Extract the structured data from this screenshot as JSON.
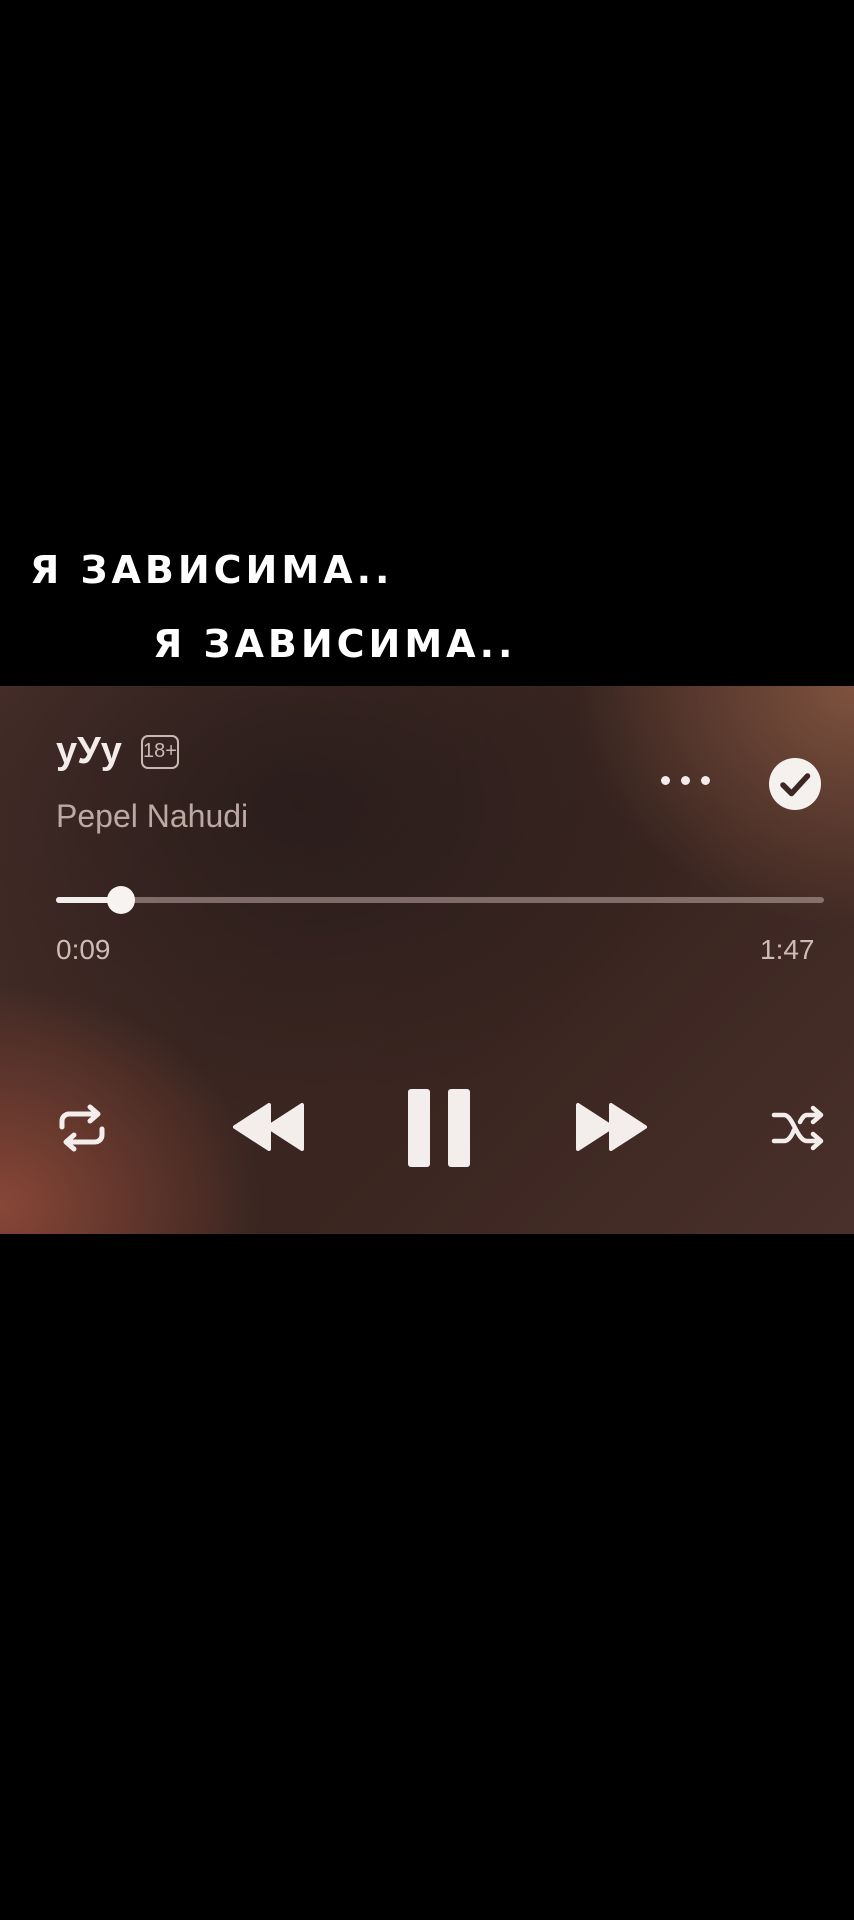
{
  "captions": {
    "line1": "Я ЗАВИСИМА..",
    "line2": "Я ЗАВИСИМА.."
  },
  "track": {
    "title": "уУу",
    "explicit_badge": "18+",
    "artist": "Pepel Nahudi"
  },
  "progress": {
    "elapsed": "0:09",
    "total": "1:47",
    "fraction": 0.084
  },
  "icons": {
    "more": "more-dots-icon",
    "saved": "checkmark-circle-icon",
    "repeat": "repeat-icon",
    "rewind": "rewind-icon",
    "pause": "pause-icon",
    "forward": "fast-forward-icon",
    "shuffle": "shuffle-icon"
  },
  "colors": {
    "foreground": "#f3eeec",
    "secondary_text": "#bca9a3",
    "background": "#000000"
  }
}
